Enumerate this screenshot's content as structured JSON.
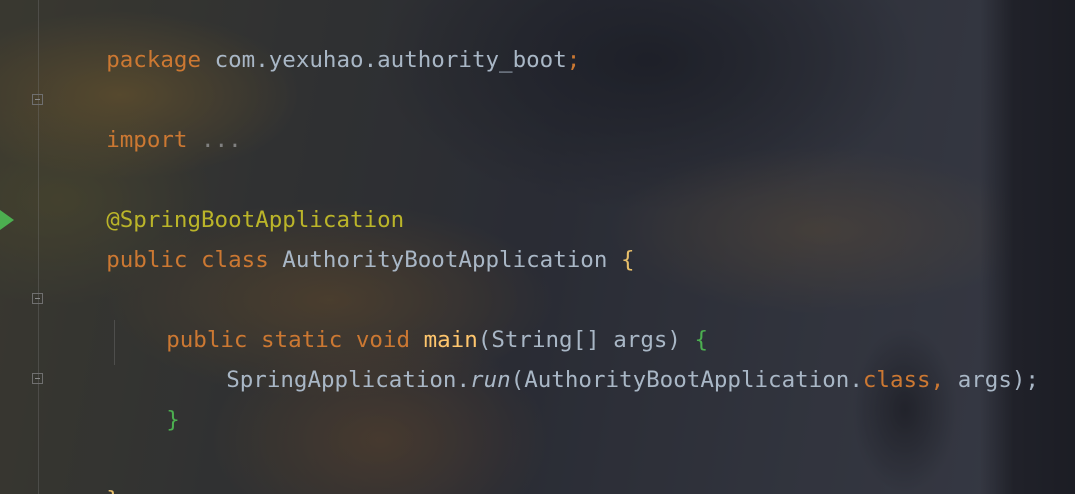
{
  "editor": {
    "lines": {
      "package": {
        "keyword": "package",
        "name": "com.yexuhao.authority_boot",
        "semicolon": ";"
      },
      "import": {
        "keyword": "import",
        "folded": "..."
      },
      "annotation": "@SpringBootApplication",
      "class_decl": {
        "mod": "public",
        "kw": "class",
        "name": "AuthorityBootApplication",
        "brace": "{"
      },
      "main_decl": {
        "mod1": "public",
        "mod2": "static",
        "type": "void",
        "name": "main",
        "open": "(",
        "param_type": "String[]",
        "param_name": "args",
        "close": ")",
        "brace": "{"
      },
      "call": {
        "target": "SpringApplication",
        "dot": ".",
        "method": "run",
        "open": "(",
        "arg_class": "AuthorityBootApplication",
        "dot2": ".",
        "class_kw": "class",
        "comma": ",",
        "arg2": "args",
        "close": ");"
      },
      "close_main": "}",
      "close_class": "}"
    }
  }
}
